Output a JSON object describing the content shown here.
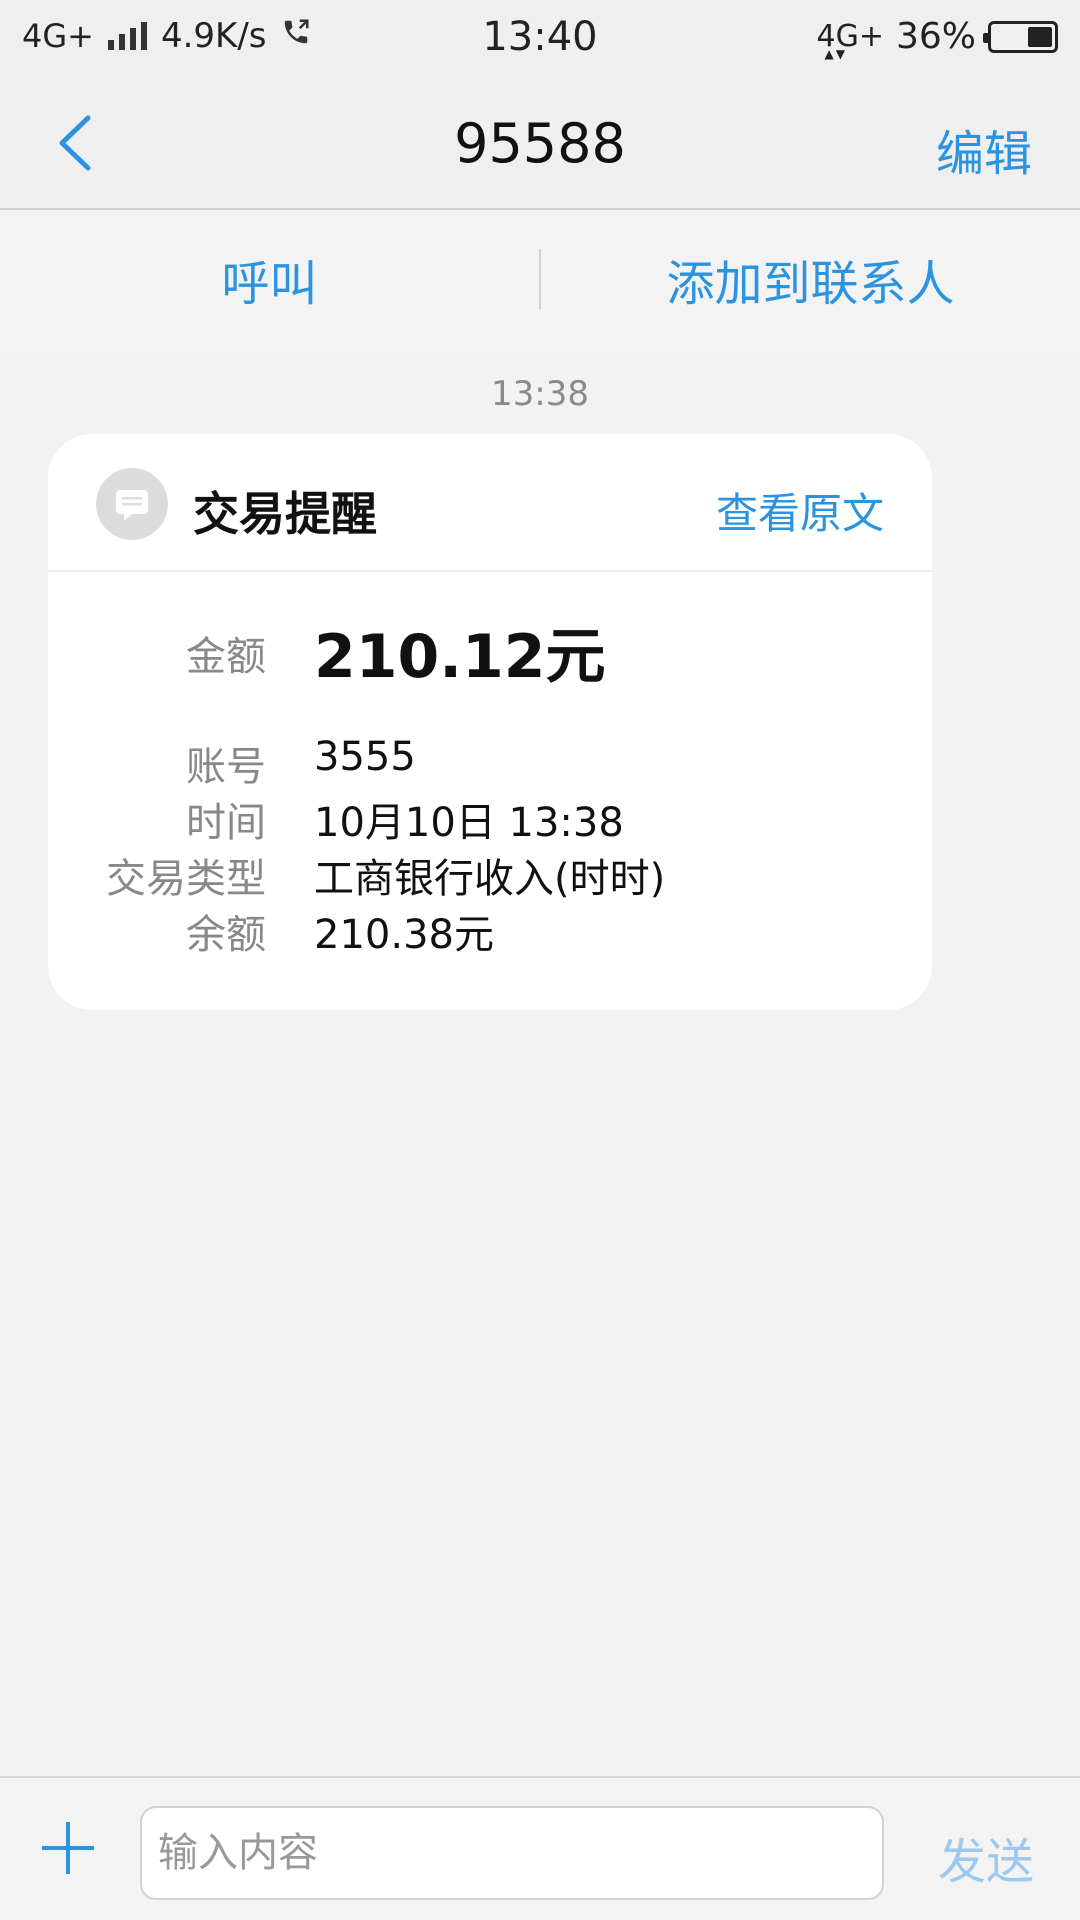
{
  "status_bar": {
    "network_left": "4G+",
    "speed": "4.9K/s",
    "time": "13:40",
    "network_right": "4G+",
    "battery": "36%"
  },
  "nav": {
    "title": "95588",
    "edit_label": "编辑"
  },
  "actions": {
    "call_label": "呼叫",
    "add_contact_label": "添加到联系人"
  },
  "message": {
    "timestamp": "13:38",
    "card": {
      "title": "交易提醒",
      "view_original_label": "查看原文",
      "amount": {
        "label": "金额",
        "value": "210.12元"
      },
      "fields": [
        {
          "label": "账号",
          "value": "3555"
        },
        {
          "label": "时间",
          "value": "10月10日 13:38"
        },
        {
          "label": "交易类型",
          "value": "工商银行收入(时时)"
        },
        {
          "label": "余额",
          "value": "210.38元"
        }
      ]
    }
  },
  "composer": {
    "placeholder": "输入内容",
    "send_label": "发送"
  },
  "colors": {
    "accent": "#2c93df",
    "send_disabled": "#9cc9ee",
    "background": "#f2f2f2"
  }
}
